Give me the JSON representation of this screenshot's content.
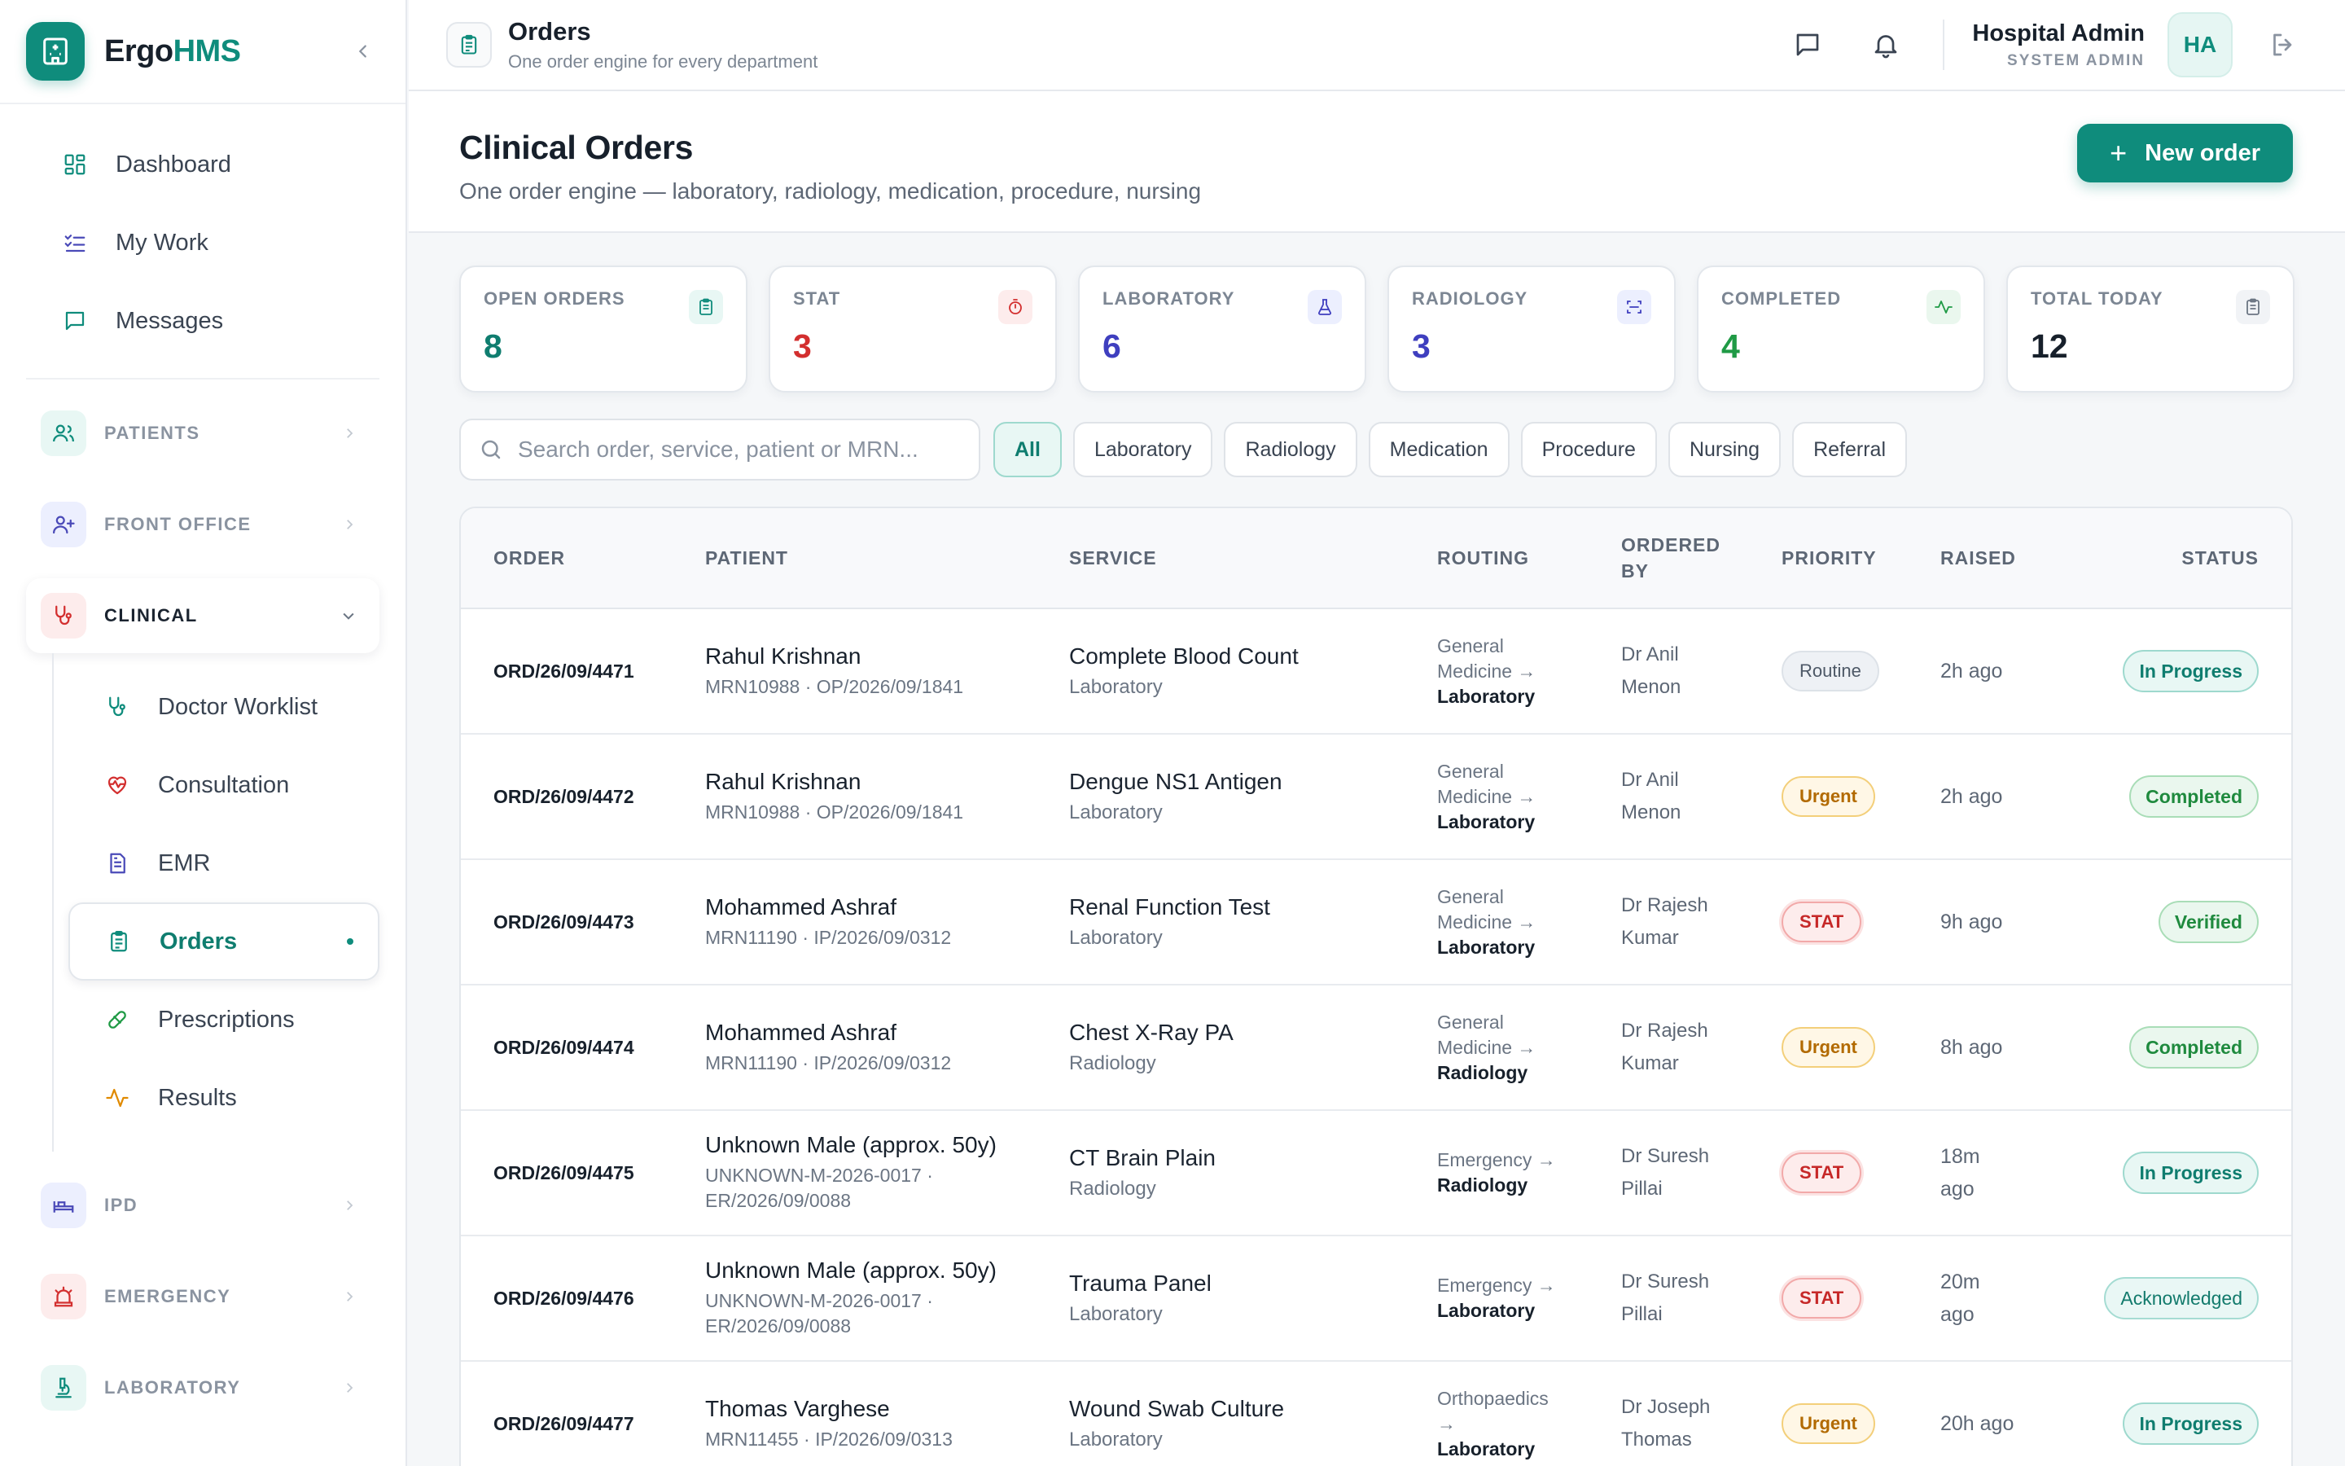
{
  "brand": {
    "name_a": "Ergo",
    "name_b": "HMS"
  },
  "sidebar": {
    "top": [
      {
        "label": "Dashboard"
      },
      {
        "label": "My Work"
      },
      {
        "label": "Messages"
      }
    ],
    "groups": {
      "patients": "PATIENTS",
      "front_office": "FRONT OFFICE",
      "clinical": "CLINICAL",
      "ipd": "IPD",
      "emergency": "EMERGENCY",
      "laboratory": "LABORATORY"
    },
    "clinical_items": [
      {
        "label": "Doctor Worklist"
      },
      {
        "label": "Consultation"
      },
      {
        "label": "EMR"
      },
      {
        "label": "Orders"
      },
      {
        "label": "Prescriptions"
      },
      {
        "label": "Results"
      }
    ]
  },
  "topbar": {
    "title": "Orders",
    "subtitle": "One order engine for every department",
    "user_name": "Hospital Admin",
    "user_role": "SYSTEM ADMIN",
    "avatar": "HA"
  },
  "page": {
    "title": "Clinical Orders",
    "subtitle": "One order engine — laboratory, radiology, medication, procedure, nursing",
    "new_order": "New order"
  },
  "stats": [
    {
      "label": "OPEN ORDERS",
      "value": "8",
      "color": "#0f7d6f"
    },
    {
      "label": "STAT",
      "value": "3",
      "color": "#d32f2f"
    },
    {
      "label": "LABORATORY",
      "value": "6",
      "color": "#3f3fbf"
    },
    {
      "label": "RADIOLOGY",
      "value": "3",
      "color": "#3f3fbf"
    },
    {
      "label": "COMPLETED",
      "value": "4",
      "color": "#1f9a45"
    },
    {
      "label": "TOTAL TODAY",
      "value": "12",
      "color": "#17202b"
    }
  ],
  "filters": {
    "search_placeholder": "Search order, service, patient or MRN...",
    "chips": [
      "All",
      "Laboratory",
      "Radiology",
      "Medication",
      "Procedure",
      "Nursing",
      "Referral"
    ]
  },
  "table": {
    "headers": {
      "order": "ORDER",
      "patient": "PATIENT",
      "service": "SERVICE",
      "routing": "ROUTING",
      "ordered_by_1": "ORDERED",
      "ordered_by_2": "BY",
      "priority": "PRIORITY",
      "raised": "RAISED",
      "status": "STATUS"
    },
    "rows": [
      {
        "order": "ORD/26/09/4471",
        "patient": "Rahul Krishnan",
        "meta1": "MRN10988 · OP/2026/09/1841",
        "meta2": "",
        "service": "Complete Blood Count",
        "category": "Laboratory",
        "route1": "General",
        "route2": "Medicine →",
        "route_to": "Laboratory",
        "ob1": "Dr Anil",
        "ob2": "Menon",
        "priority": "Routine",
        "raised1": "2h ago",
        "raised2": "",
        "status": "In Progress"
      },
      {
        "order": "ORD/26/09/4472",
        "patient": "Rahul Krishnan",
        "meta1": "MRN10988 · OP/2026/09/1841",
        "meta2": "",
        "service": "Dengue NS1 Antigen",
        "category": "Laboratory",
        "route1": "General",
        "route2": "Medicine →",
        "route_to": "Laboratory",
        "ob1": "Dr Anil",
        "ob2": "Menon",
        "priority": "Urgent",
        "raised1": "2h ago",
        "raised2": "",
        "status": "Completed"
      },
      {
        "order": "ORD/26/09/4473",
        "patient": "Mohammed Ashraf",
        "meta1": "MRN11190 · IP/2026/09/0312",
        "meta2": "",
        "service": "Renal Function Test",
        "category": "Laboratory",
        "route1": "General",
        "route2": "Medicine →",
        "route_to": "Laboratory",
        "ob1": "Dr Rajesh",
        "ob2": "Kumar",
        "priority": "STAT",
        "raised1": "9h ago",
        "raised2": "",
        "status": "Verified"
      },
      {
        "order": "ORD/26/09/4474",
        "patient": "Mohammed Ashraf",
        "meta1": "MRN11190 · IP/2026/09/0312",
        "meta2": "",
        "service": "Chest X-Ray PA",
        "category": "Radiology",
        "route1": "General",
        "route2": "Medicine →",
        "route_to": "Radiology",
        "ob1": "Dr Rajesh",
        "ob2": "Kumar",
        "priority": "Urgent",
        "raised1": "8h ago",
        "raised2": "",
        "status": "Completed"
      },
      {
        "order": "ORD/26/09/4475",
        "patient": "Unknown Male (approx. 50y)",
        "meta1": "UNKNOWN-M-2026-0017 ·",
        "meta2": "ER/2026/09/0088",
        "service": "CT Brain Plain",
        "category": "Radiology",
        "route1": "",
        "route2": "Emergency →",
        "route_to": "Radiology",
        "ob1": "Dr Suresh",
        "ob2": "Pillai",
        "priority": "STAT",
        "raised1": "18m",
        "raised2": "ago",
        "status": "In Progress"
      },
      {
        "order": "ORD/26/09/4476",
        "patient": "Unknown Male (approx. 50y)",
        "meta1": "UNKNOWN-M-2026-0017 ·",
        "meta2": "ER/2026/09/0088",
        "service": "Trauma Panel",
        "category": "Laboratory",
        "route1": "",
        "route2": "Emergency →",
        "route_to": "Laboratory",
        "ob1": "Dr Suresh",
        "ob2": "Pillai",
        "priority": "STAT",
        "raised1": "20m",
        "raised2": "ago",
        "status": "Acknowledged"
      },
      {
        "order": "ORD/26/09/4477",
        "patient": "Thomas Varghese",
        "meta1": "MRN11455 · IP/2026/09/0313",
        "meta2": "",
        "service": "Wound Swab Culture",
        "category": "Laboratory",
        "route1": "Orthopaedics",
        "route2": "→",
        "route_to": "Laboratory",
        "ob1": "Dr Joseph",
        "ob2": "Thomas",
        "priority": "Urgent",
        "raised1": "20h ago",
        "raised2": "",
        "status": "In Progress"
      }
    ]
  }
}
